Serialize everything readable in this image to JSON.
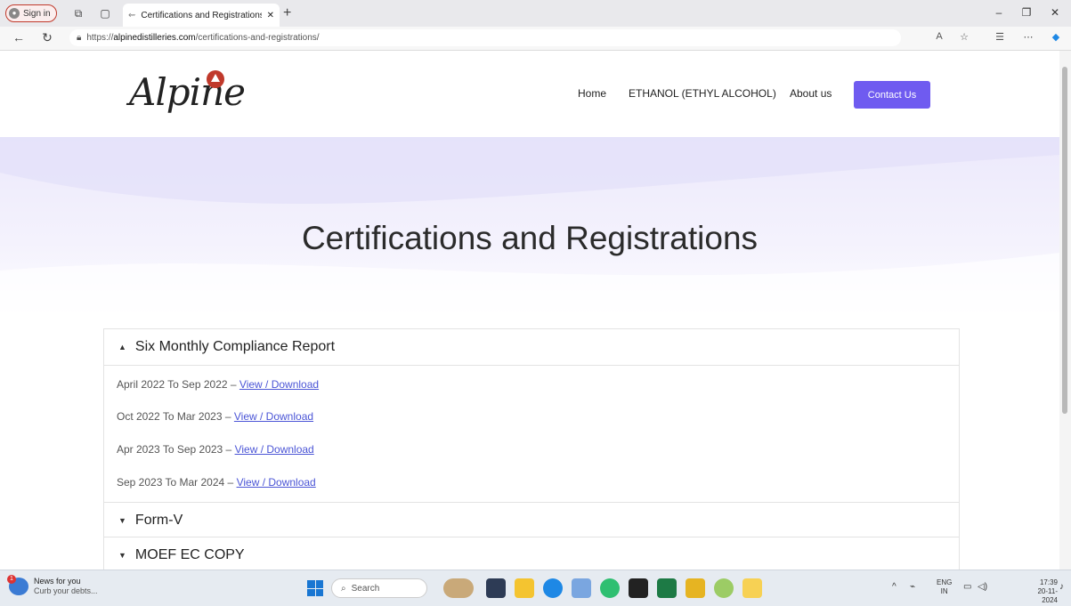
{
  "browser": {
    "signin_label": "Sign in",
    "tab_title": "Certifications and Registrations -",
    "new_tab": "+",
    "url_prefix": "https://",
    "url_domain": "alpinedistilleries.com",
    "url_path": "/certifications-and-registrations/"
  },
  "site": {
    "logo": "Alpine",
    "nav": [
      "Home",
      "ETHANOL (ETHYL ALCOHOL)",
      "About us"
    ],
    "contact_label": "Contact Us",
    "page_title": "Certifications and Registrations"
  },
  "accordion": [
    {
      "title": "Six Monthly Compliance Report",
      "expanded": true,
      "items": [
        {
          "period": "April 2022 To Sep 2022 –",
          "link": "View / Download"
        },
        {
          "period": "Oct 2022 To Mar 2023 –",
          "link": "View / Download"
        },
        {
          "period": "Apr 2023 To Sep 2023 –",
          "link": "View / Download"
        },
        {
          "period": "Sep 2023 To Mar 2024 –",
          "link": "View / Download"
        }
      ]
    },
    {
      "title": "Form-V",
      "expanded": false
    },
    {
      "title": "MOEF EC COPY",
      "expanded": false
    }
  ],
  "taskbar": {
    "news_title": "News for you",
    "news_sub": "Curb your debts...",
    "news_badge": "1",
    "search_label": "Search",
    "lang_top": "ENG",
    "lang_bottom": "IN",
    "time": "17:39",
    "date": "20-11-2024"
  },
  "colors": {
    "accent": "#6f5bf0",
    "link": "#4b55d6",
    "brand_red": "#c0392b"
  }
}
